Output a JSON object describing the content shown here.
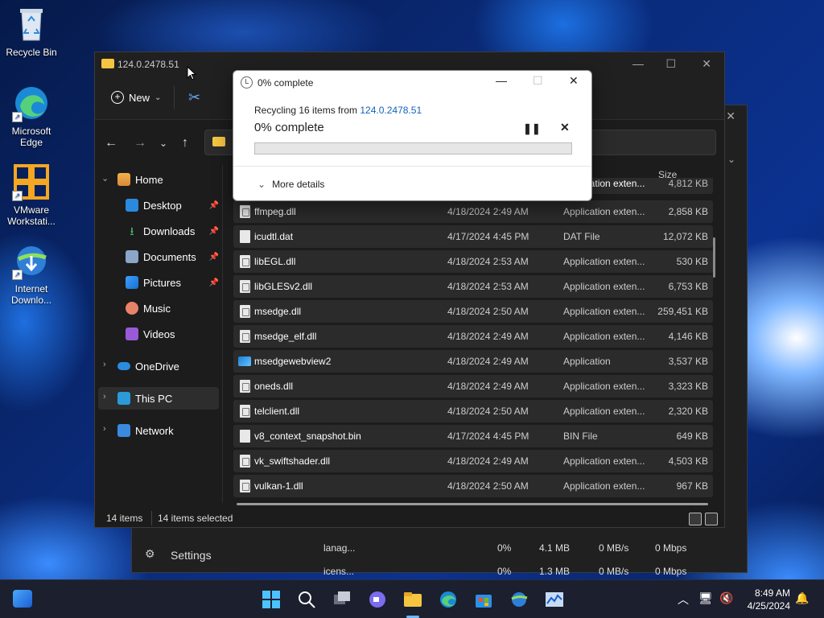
{
  "desktop": {
    "icons": [
      {
        "label": "Recycle Bin",
        "name": "recycle-bin"
      },
      {
        "label": "Microsoft Edge",
        "name": "microsoft-edge"
      },
      {
        "label": "VMware Workstati...",
        "name": "vmware-workstation"
      },
      {
        "label": "Internet Downlo...",
        "name": "internet-download-manager"
      }
    ]
  },
  "explorer": {
    "title": "124.0.2478.51",
    "new_label": "New",
    "column_size": "Size",
    "sidebar": [
      {
        "label": "Home",
        "icon": "home-icon"
      },
      {
        "label": "Desktop",
        "icon": "desktop-icon"
      },
      {
        "label": "Downloads",
        "icon": "download-icon"
      },
      {
        "label": "Documents",
        "icon": "document-icon"
      },
      {
        "label": "Pictures",
        "icon": "pictures-icon"
      },
      {
        "label": "Music",
        "icon": "music-icon"
      },
      {
        "label": "Videos",
        "icon": "video-icon"
      },
      {
        "label": "OneDrive",
        "icon": "cloud-icon"
      },
      {
        "label": "This PC",
        "icon": "computer-icon"
      },
      {
        "label": "Network",
        "icon": "network-icon"
      }
    ],
    "partial_row": {
      "type": "Application exten...",
      "size": "4,812 KB"
    },
    "files": [
      {
        "name": "ffmpeg.dll",
        "date": "4/18/2024 2:49 AM",
        "type": "Application exten...",
        "size": "2,858 KB",
        "kind": "dll"
      },
      {
        "name": "icudtl.dat",
        "date": "4/17/2024 4:45 PM",
        "type": "DAT File",
        "size": "12,072 KB",
        "kind": "file"
      },
      {
        "name": "libEGL.dll",
        "date": "4/18/2024 2:53 AM",
        "type": "Application exten...",
        "size": "530 KB",
        "kind": "dll"
      },
      {
        "name": "libGLESv2.dll",
        "date": "4/18/2024 2:53 AM",
        "type": "Application exten...",
        "size": "6,753 KB",
        "kind": "dll"
      },
      {
        "name": "msedge.dll",
        "date": "4/18/2024 2:50 AM",
        "type": "Application exten...",
        "size": "259,451 KB",
        "kind": "dll"
      },
      {
        "name": "msedge_elf.dll",
        "date": "4/18/2024 2:49 AM",
        "type": "Application exten...",
        "size": "4,146 KB",
        "kind": "dll"
      },
      {
        "name": "msedgewebview2",
        "date": "4/18/2024 2:49 AM",
        "type": "Application",
        "size": "3,537 KB",
        "kind": "app"
      },
      {
        "name": "oneds.dll",
        "date": "4/18/2024 2:49 AM",
        "type": "Application exten...",
        "size": "3,323 KB",
        "kind": "dll"
      },
      {
        "name": "telclient.dll",
        "date": "4/18/2024 2:50 AM",
        "type": "Application exten...",
        "size": "2,320 KB",
        "kind": "dll"
      },
      {
        "name": "v8_context_snapshot.bin",
        "date": "4/17/2024 4:45 PM",
        "type": "BIN File",
        "size": "649 KB",
        "kind": "file"
      },
      {
        "name": "vk_swiftshader.dll",
        "date": "4/18/2024 2:49 AM",
        "type": "Application exten...",
        "size": "4,503 KB",
        "kind": "dll"
      },
      {
        "name": "vulkan-1.dll",
        "date": "4/18/2024 2:50 AM",
        "type": "Application exten...",
        "size": "967 KB",
        "kind": "dll"
      }
    ],
    "status_items": "14 items",
    "status_selected": "14 items selected"
  },
  "dialog": {
    "title": "0% complete",
    "line_prefix": "Recycling 16 items from ",
    "line_link": "124.0.2478.51",
    "percent_text": "0% complete",
    "progress": 0,
    "more_details": "More details"
  },
  "taskmgr": {
    "settings": "Settings",
    "rows": [
      {
        "name": "lanag...",
        "cpu": "0%",
        "mem": "4.1 MB",
        "disk": "0 MB/s",
        "net": "0 Mbps"
      },
      {
        "name": "icens...",
        "cpu": "0%",
        "mem": "1.3 MB",
        "disk": "0 MB/s",
        "net": "0 Mbps"
      }
    ]
  },
  "taskbar": {
    "time": "8:49 AM",
    "date": "4/25/2024"
  }
}
